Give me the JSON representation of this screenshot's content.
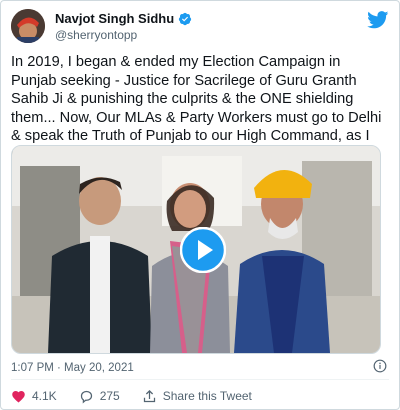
{
  "author": {
    "display_name": "Navjot Singh Sidhu",
    "handle": "@sherryontopp"
  },
  "tweet": {
    "text": "In 2019, I began & ended my Election Campaign in Punjab seeking - Justice for Sacrilege of Guru Granth Sahib Ji & punishing the culprits & the ONE shielding them... Now, Our MLAs & Party Workers must go to Delhi & speak the Truth of Punjab to our High Command, as I regularly do !",
    "timestamp": "1:07 PM · May 20, 2021"
  },
  "actions": {
    "likes": "4.1K",
    "replies": "275",
    "share_label": "Share this Tweet"
  },
  "colors": {
    "twitter_blue": "#1d9bf0",
    "like_red": "#e0245e",
    "secondary_text": "#536471"
  },
  "icons": [
    "verified-badge-icon",
    "twitter-bird-icon",
    "play-icon",
    "info-icon",
    "heart-icon",
    "reply-icon",
    "share-icon"
  ]
}
